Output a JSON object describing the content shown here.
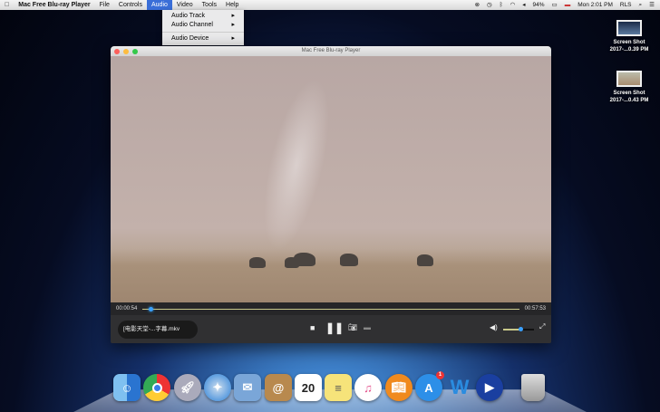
{
  "menubar": {
    "app": "Mac Free Blu-ray Player",
    "items": [
      "File",
      "Controls",
      "Audio",
      "Video",
      "Tools",
      "Help"
    ],
    "battery": "94%",
    "clock": "Mon 2:01 PM",
    "user": "RLS"
  },
  "audio_menu": {
    "items": [
      "Audio Track",
      "Audio Channel",
      "Audio Device"
    ]
  },
  "desktop": [
    {
      "line1": "Screen Shot",
      "line2": "2017-...0.39 PM"
    },
    {
      "line1": "Screen Shot",
      "line2": "2017-...0.43 PM"
    }
  ],
  "player": {
    "title": "Mac Free Blu-ray Player",
    "elapsed": "00:00:54",
    "total": "00:57:53",
    "progress": 0.016,
    "file": "[电影天堂-...字幕.mkv",
    "volume": 0.55
  },
  "dock": {
    "calendar_day": "20",
    "appstore_badge": "1",
    "word": "W"
  }
}
